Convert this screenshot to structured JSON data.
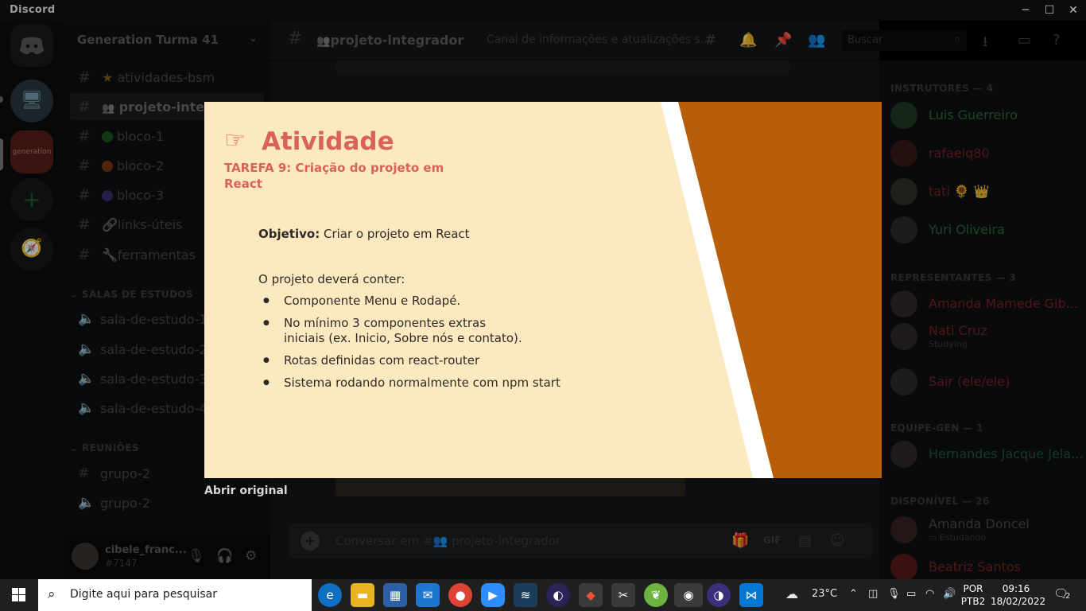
{
  "window": {
    "app_name": "Discord",
    "controls": [
      "─",
      "☐",
      "✕"
    ]
  },
  "server": {
    "name": "Generation Turma 41",
    "chevron": "⌄"
  },
  "channels": [
    {
      "label": "atividades-bsm",
      "icon": "★",
      "icon_color": "#a98a2a"
    },
    {
      "label": "projeto-integrador",
      "icon": "👥",
      "active": true
    },
    {
      "label": "bloco-1",
      "dot": "#2e9e3a"
    },
    {
      "label": "bloco-2",
      "dot": "#d2611d"
    },
    {
      "label": "bloco-3",
      "dot": "#5d4fa8"
    },
    {
      "label": "links-úteis",
      "icon": "🔗"
    },
    {
      "label": "ferramentas",
      "icon": "🔧"
    }
  ],
  "categories": {
    "study": "SALAS DE ESTUDOS",
    "meetings": "REUNIÕES"
  },
  "voice_channels": [
    "sala-de-estudo-1",
    "sala-de-estudo-2",
    "sala-de-estudo-3",
    "sala-de-estudo-4"
  ],
  "meeting_channels": [
    "grupo-2",
    "grupo-2"
  ],
  "user": {
    "name": "cibele_franc...",
    "tag": "#7147"
  },
  "topbar": {
    "channel": "projeto-integrador",
    "topic": "Canal de informações e atualizações s...",
    "search_placeholder": "Buscar"
  },
  "composer": {
    "placeholder": "Conversar em #👥 projeto-integrador",
    "gif": "GIF"
  },
  "members": {
    "instructors_header": "INSTRUTORES — 4",
    "instructors": [
      {
        "name": "Luis Guerreiro",
        "color": "#2f6b36"
      },
      {
        "name": "rafaelq80",
        "color": "#7c2323"
      },
      {
        "name": "tati 🌻 👑",
        "color": "#7c2323"
      },
      {
        "name": "Yuri Oliveira",
        "color": "#2f6b36"
      }
    ],
    "reps_header": "REPRESENTANTES — 3",
    "reps": [
      {
        "name": "Amanda Mamede Gib...",
        "color": "#7c2323"
      },
      {
        "name": "Nati Cruz",
        "color": "#7c2323",
        "status": "Studying"
      },
      {
        "name": "Sair (ele/ele)",
        "color": "#7c2323"
      }
    ],
    "team_header": "EQUIPE-GEN — 1",
    "team": [
      {
        "name": "Hernandes Jacque Jela...",
        "color": "#1f5a3a"
      }
    ],
    "available_header": "DISPONÍVEL — 26",
    "available": [
      {
        "name": "Amanda Doncel",
        "color": "#4a4b4e",
        "status": "Estudando"
      },
      {
        "name": "Beatriz Santos",
        "color": "#7c2323"
      }
    ]
  },
  "slide": {
    "hand_icon": "☞",
    "heading": "Atividade",
    "task": "TAREFA 9: Criação do projeto em React",
    "objective_label": "Objetivo:",
    "objective_text": " Criar o projeto em React",
    "intro": "O projeto deverá conter:",
    "items": [
      "Componente Menu e Rodapé.",
      "No mínimo 3 componentes extras iniciais (ex. Inicio, Sobre nós e contato).",
      "Rotas definidas com react-router",
      "Sistema rodando normalmente com npm start"
    ]
  },
  "open_original": "Abrir original",
  "taskbar": {
    "search_placeholder": "Digite aqui para pesquisar",
    "weather": "23°C",
    "lang_top": "POR",
    "lang_bottom": "PTB2",
    "time": "09:16",
    "date": "18/02/2022",
    "notifications": "2"
  }
}
